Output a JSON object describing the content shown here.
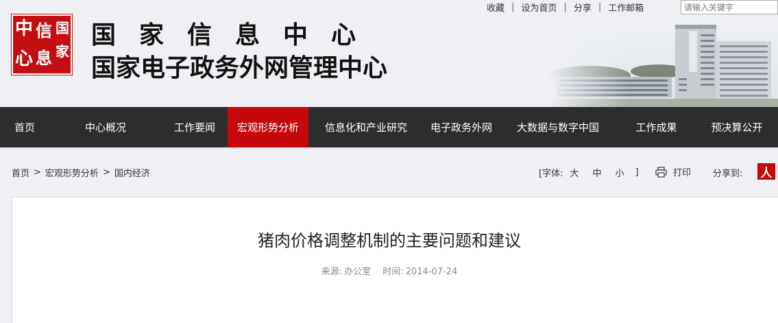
{
  "header": {
    "logo_chars": [
      "中",
      "心",
      "信",
      "息",
      "国",
      "家"
    ],
    "title_line1": "国家信息中心",
    "title_line2": "国家电子政务外网管理中心",
    "colors": {
      "brand_red": "#c40f12"
    }
  },
  "top_links": {
    "items": [
      "收藏",
      "设为首页",
      "分享",
      "工作邮箱"
    ],
    "separator": "|"
  },
  "search": {
    "placeholder": "请输入关键字"
  },
  "nav": {
    "items": [
      {
        "label": "首页",
        "active": false
      },
      {
        "label": "中心概况",
        "active": false
      },
      {
        "label": "工作要闻",
        "active": false
      },
      {
        "label": "宏观形势分析",
        "active": true
      },
      {
        "label": "信息化和产业研究",
        "active": false
      },
      {
        "label": "电子政务外网",
        "active": false
      },
      {
        "label": "大数据与数字中国",
        "active": false
      },
      {
        "label": "工作成果",
        "active": false
      },
      {
        "label": "预决算公开",
        "active": false
      }
    ],
    "colors": {
      "background": "#2d2d2d",
      "active": "#c6070c"
    }
  },
  "breadcrumb": {
    "items": [
      "首页",
      "宏观形势分析",
      "国内经济"
    ],
    "separator": ">"
  },
  "tools": {
    "font_label": "[字体:",
    "font_large": "大",
    "font_medium": "中",
    "font_small": "小",
    "font_close": "]",
    "print_label": "打印",
    "print_icon": "printer-icon",
    "share_label": "分享到:",
    "share_icon": "people-daily-icon",
    "share_icon_char": "人"
  },
  "article": {
    "title": "猪肉价格调整机制的主要问题和建议",
    "source_label": "来源:",
    "source": "办公室",
    "time_label": "时间:",
    "time": "2014-07-24"
  }
}
